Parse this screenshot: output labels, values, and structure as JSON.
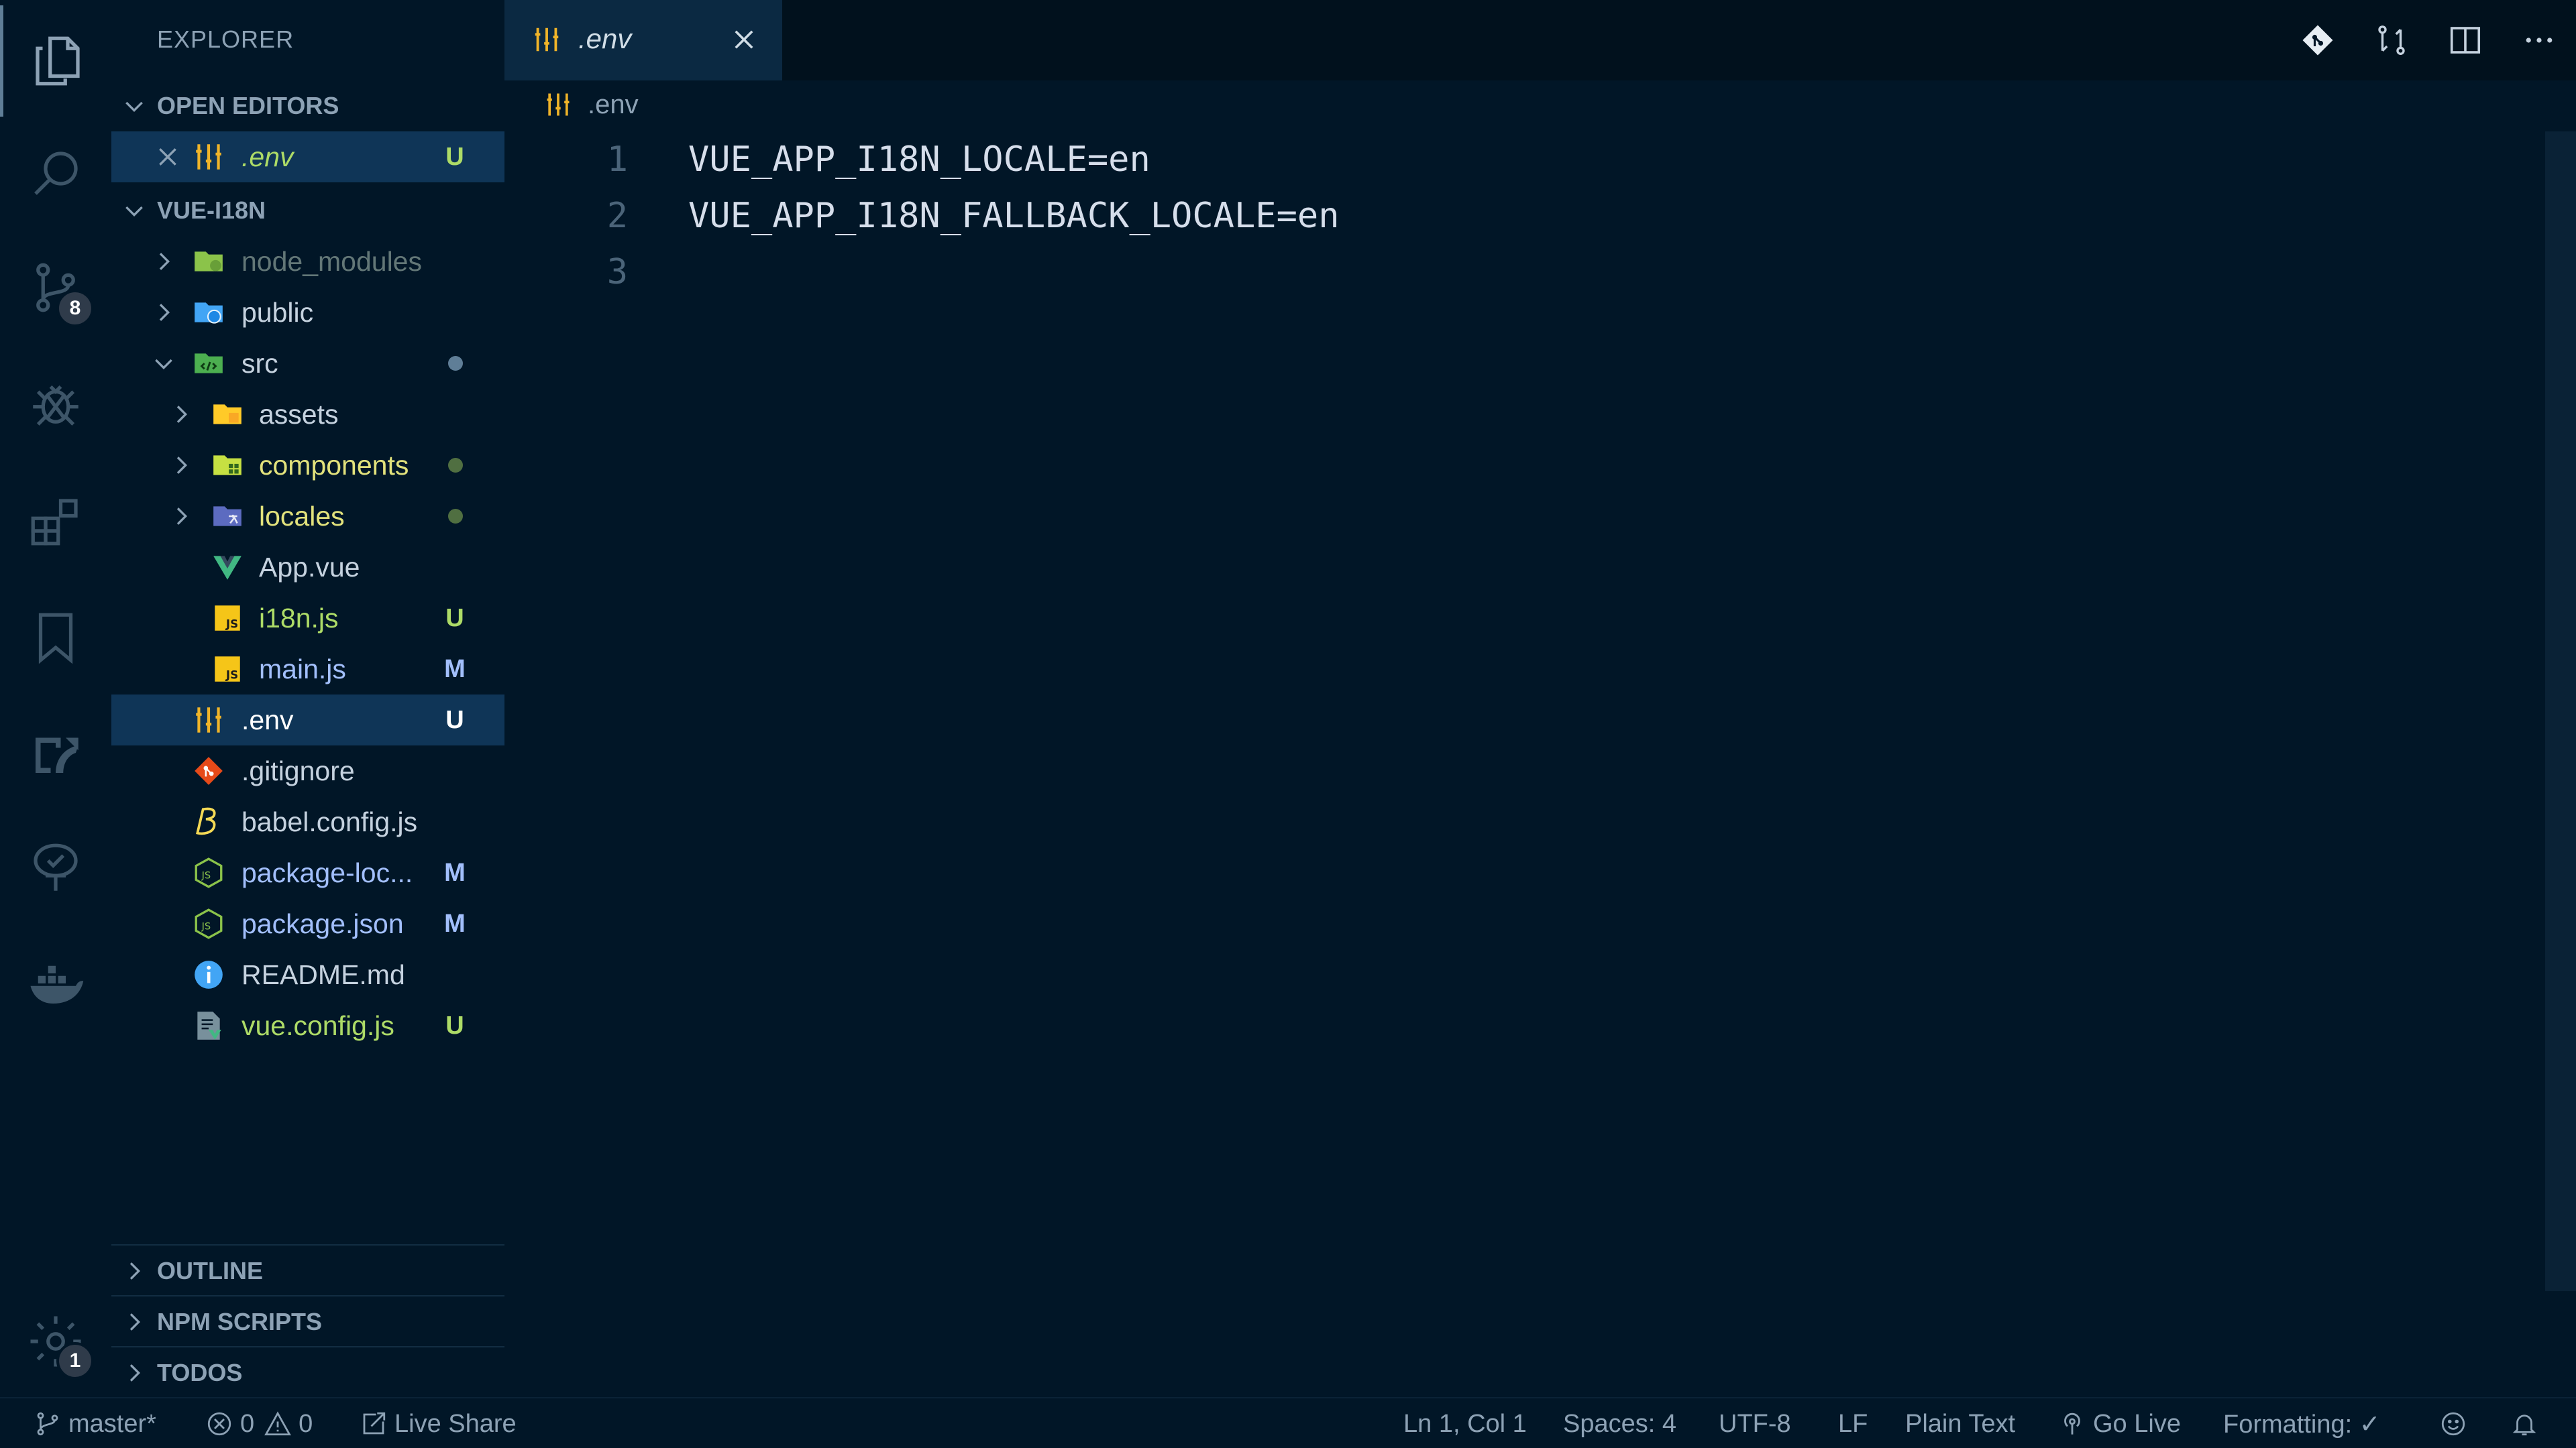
{
  "colors": {
    "background": "#011627",
    "accent_green": "#addb67",
    "accent_yellow": "#e2e27c",
    "modified_blue": "#a2bffc",
    "muted": "#637777"
  },
  "activity_bar": {
    "items": [
      {
        "icon": "files-icon"
      },
      {
        "icon": "search-icon"
      },
      {
        "icon": "source-control-icon",
        "badge": "8"
      },
      {
        "icon": "debug-icon"
      },
      {
        "icon": "extensions-icon"
      },
      {
        "icon": "bookmark-icon"
      },
      {
        "icon": "remote-explorer-icon"
      },
      {
        "icon": "git-graph-icon"
      },
      {
        "icon": "docker-icon"
      }
    ],
    "settings_badge": "1"
  },
  "sidebar": {
    "title": "EXPLORER",
    "open_editors": {
      "header": "OPEN EDITORS",
      "items": [
        {
          "label": ".env",
          "badge": "U"
        }
      ]
    },
    "project": {
      "header": "VUE-I18N",
      "items": [
        {
          "label": "node_modules"
        },
        {
          "label": "public"
        },
        {
          "label": "src"
        },
        {
          "label": "assets"
        },
        {
          "label": "components"
        },
        {
          "label": "locales"
        },
        {
          "label": "App.vue"
        },
        {
          "label": "i18n.js",
          "badge": "U"
        },
        {
          "label": "main.js",
          "badge": "M"
        },
        {
          "label": ".env",
          "badge": "U"
        },
        {
          "label": ".gitignore"
        },
        {
          "label": "babel.config.js"
        },
        {
          "label": "package-loc...",
          "badge": "M"
        },
        {
          "label": "package.json",
          "badge": "M"
        },
        {
          "label": "README.md"
        },
        {
          "label": "vue.config.js",
          "badge": "U"
        }
      ]
    },
    "outline": "OUTLINE",
    "npm_scripts": "NPM SCRIPTS",
    "todos": "TODOS"
  },
  "editor": {
    "tab": {
      "label": ".env"
    },
    "breadcrumb": ".env",
    "lines": [
      {
        "no": "1",
        "text": "VUE_APP_I18N_LOCALE=en"
      },
      {
        "no": "2",
        "text": "VUE_APP_I18N_FALLBACK_LOCALE=en"
      },
      {
        "no": "3",
        "text": ""
      }
    ]
  },
  "status_bar": {
    "branch": "master*",
    "errors": "0",
    "warnings": "0",
    "live_share": "Live Share",
    "position": "Ln 1, Col 1",
    "spaces": "Spaces: 4",
    "encoding": "UTF-8",
    "eol": "LF",
    "language": "Plain Text",
    "go_live": "Go Live",
    "formatting": "Formatting: ✓"
  }
}
